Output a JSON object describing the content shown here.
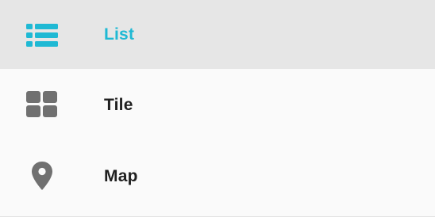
{
  "menu": {
    "items": [
      {
        "label": "List",
        "icon": "list-icon",
        "selected": true
      },
      {
        "label": "Tile",
        "icon": "tile-grid-icon",
        "selected": false
      },
      {
        "label": "Map",
        "icon": "map-pin-icon",
        "selected": false
      }
    ]
  },
  "colors": {
    "accent": "#1fb9d4",
    "icon_gray": "#707070",
    "selected_background": "#e6e6e6",
    "text": "#1f1f1f"
  }
}
